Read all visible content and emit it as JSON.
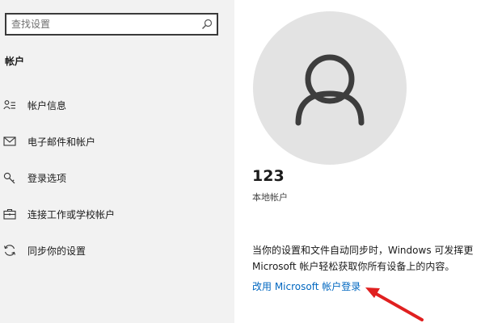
{
  "search": {
    "placeholder": "查找设置",
    "icon": "search-icon"
  },
  "sidebar": {
    "section_title": "帐户",
    "items": [
      {
        "label": "帐户信息",
        "icon": "person-card-icon"
      },
      {
        "label": "电子邮件和帐户",
        "icon": "mail-icon"
      },
      {
        "label": "登录选项",
        "icon": "key-icon"
      },
      {
        "label": "连接工作或学校帐户",
        "icon": "briefcase-icon"
      },
      {
        "label": "同步你的设置",
        "icon": "sync-icon"
      }
    ]
  },
  "account": {
    "name": "123",
    "type": "本地帐户",
    "description_line1": "当你的设置和文件自动同步时，Windows 可发挥更",
    "description_line2": "Microsoft 帐户轻松获取你所有设备上的内容。",
    "link_label": "改用 Microsoft 帐户登录"
  },
  "colors": {
    "sidebar_bg": "#f2f2f2",
    "link": "#0067c0",
    "annotation_arrow": "#e02020",
    "avatar_bg": "#e3e3e3"
  }
}
